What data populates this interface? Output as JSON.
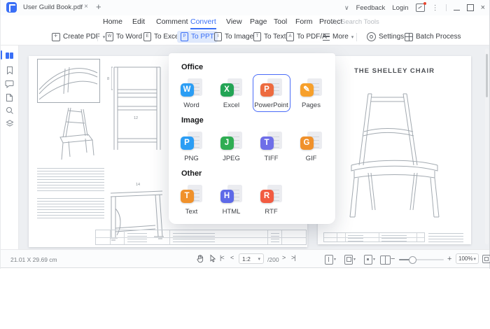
{
  "window": {
    "tab_title": "User Guild Book.pdf",
    "feedback_label": "Feedback",
    "login_label": "Login"
  },
  "menu": {
    "items": [
      "Home",
      "Edit",
      "Comment",
      "Convert",
      "View",
      "Page",
      "Tool",
      "Form",
      "Protect"
    ],
    "active_item": "Convert",
    "search_placeholder": "Search Tools"
  },
  "toolbar": {
    "create_pdf_label": "Create PDF",
    "buttons": [
      {
        "label": "To Word",
        "letter": "W"
      },
      {
        "label": "To Excel",
        "letter": "E"
      },
      {
        "label": "To PPT",
        "letter": "P"
      },
      {
        "label": "To Image",
        "letter": "I"
      },
      {
        "label": "To Text",
        "letter": "T"
      },
      {
        "label": "To PDF/A",
        "letter": "A"
      }
    ],
    "active_button": "To PPT",
    "more_label": "More",
    "settings_label": "Settings",
    "batch_label": "Batch Process"
  },
  "convert_panel": {
    "sections": [
      {
        "title": "Office",
        "items": [
          {
            "label": "Word",
            "letter": "W",
            "color": "#2b9df4"
          },
          {
            "label": "Excel",
            "letter": "X",
            "color": "#23a455"
          },
          {
            "label": "PowerPoint",
            "letter": "P",
            "color": "#ed6b3f",
            "selected": true
          },
          {
            "label": "Pages",
            "letter": "✎",
            "color": "#f7a02b"
          }
        ]
      },
      {
        "title": "Image",
        "items": [
          {
            "label": "PNG",
            "letter": "P",
            "color": "#2b9df4"
          },
          {
            "label": "JPEG",
            "letter": "J",
            "color": "#2fad53"
          },
          {
            "label": "TIFF",
            "letter": "T",
            "color": "#6e6ee8"
          },
          {
            "label": "GIF",
            "letter": "G",
            "color": "#f0912b"
          }
        ]
      },
      {
        "title": "Other",
        "items": [
          {
            "label": "Text",
            "letter": "T",
            "color": "#f0912b"
          },
          {
            "label": "HTML",
            "letter": "H",
            "color": "#5e6ae8"
          },
          {
            "label": "RTF",
            "letter": "R",
            "color": "#f25b41"
          }
        ]
      }
    ]
  },
  "document": {
    "right_page_title": "THE SHELLEY CHAIR",
    "dim_labels": {
      "top": "8",
      "front": "12",
      "side": "14"
    }
  },
  "status_bar": {
    "dimensions": "21.01 X 29.69 cm",
    "page_value": "1:2",
    "page_total": "/200",
    "zoom_value": "100%"
  },
  "icons": {
    "caret_down": "▾",
    "chevron_wide": "∨",
    "close": "×",
    "plus": "+",
    "minus": "−",
    "kebab": "⋮",
    "first_page": "|<",
    "prev_page": "<",
    "next_page": ">",
    "last_page": ">|"
  },
  "colors": {
    "accent": "#3a6ff6",
    "selected_border": "#4a6cf8",
    "active_button_bg": "#dfe9fc"
  }
}
